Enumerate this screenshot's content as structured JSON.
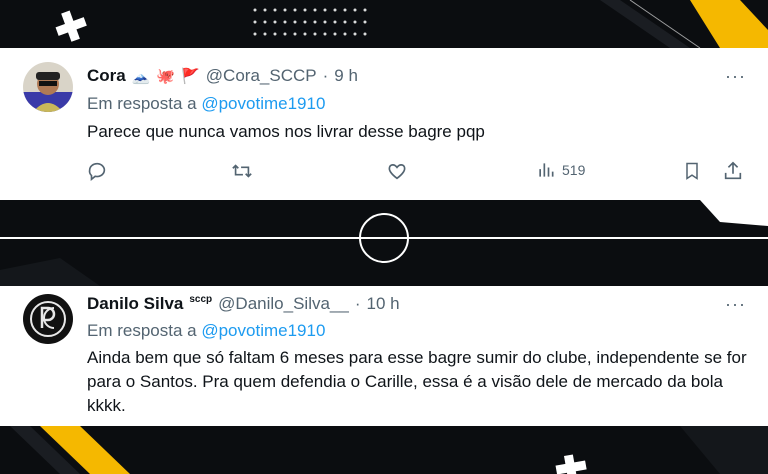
{
  "colors": {
    "background": "#0b0d10",
    "accent_yellow": "#f5b800",
    "link": "#1d9bf0",
    "text": "#0f1419",
    "muted": "#536471"
  },
  "tweets": [
    {
      "name": "Cora",
      "badges": [
        "🗻",
        "🐙",
        "🚩"
      ],
      "handle": "@Cora_SCCP",
      "separator": "·",
      "time": "9 h",
      "more": "···",
      "reply_prefix": "Em resposta a",
      "reply_to": "@povotime1910",
      "text": "Parece que nunca vamos nos livrar desse bagre pqp",
      "views": "519",
      "icons": [
        "reply-icon",
        "retweet-icon",
        "like-icon",
        "views-icon",
        "bookmark-icon",
        "share-icon"
      ]
    },
    {
      "name": "Danilo Silva",
      "badges": [
        "sccp"
      ],
      "handle": "@Danilo_Silva__",
      "separator": "·",
      "time": "10 h",
      "more": "···",
      "reply_prefix": "Em resposta a",
      "reply_to": "@povotime1910",
      "text": "Ainda bem que só faltam 6 meses para esse bagre sumir do clube, independente se for para o Santos. Pra quem defendia o Carille, essa é a visão dele de mercado da bola kkkk."
    }
  ]
}
